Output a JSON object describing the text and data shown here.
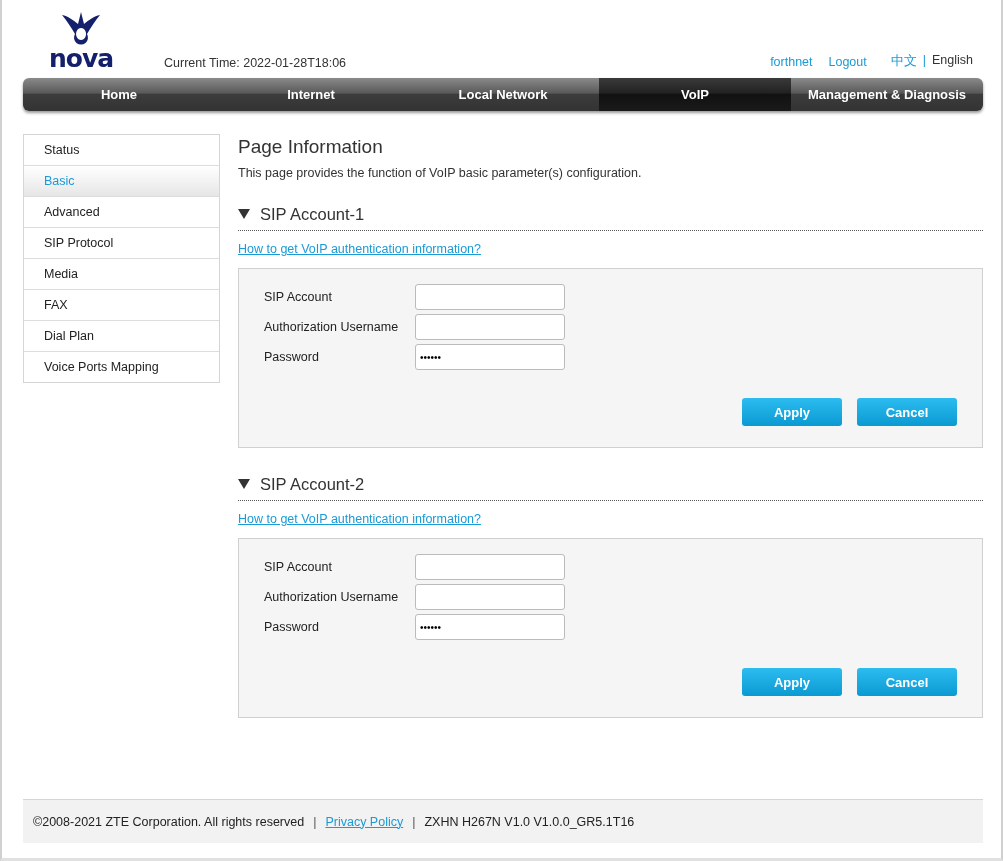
{
  "header": {
    "logo_text": "nova",
    "current_time": "Current Time: 2022-01-28T18:06",
    "user": "forthnet",
    "logout": "Logout",
    "languages": [
      {
        "label": "中文",
        "selected": false
      },
      {
        "label": "English",
        "selected": true
      }
    ],
    "language_separator": "|"
  },
  "tabs": [
    {
      "label": "Home",
      "selected": false
    },
    {
      "label": "Internet",
      "selected": false
    },
    {
      "label": "Local Network",
      "selected": false
    },
    {
      "label": "VoIP",
      "selected": true
    },
    {
      "label": "Management & Diagnosis",
      "selected": false
    }
  ],
  "sidebar": {
    "items": [
      {
        "label": "Status",
        "selected": false
      },
      {
        "label": "Basic",
        "selected": true
      },
      {
        "label": "Advanced",
        "selected": false
      },
      {
        "label": "SIP Protocol",
        "selected": false
      },
      {
        "label": "Media",
        "selected": false
      },
      {
        "label": "FAX",
        "selected": false
      },
      {
        "label": "Dial Plan",
        "selected": false
      },
      {
        "label": "Voice Ports Mapping",
        "selected": false
      }
    ]
  },
  "content": {
    "title": "Page Information",
    "description": "This page provides the function of VoIP basic parameter(s) configuration.",
    "sections": [
      {
        "title": "SIP Account-1",
        "expanded": true,
        "help_link": "How to get VoIP authentication information?",
        "fields": [
          {
            "label": "SIP Account"
          },
          {
            "label": "Authorization Username"
          },
          {
            "label": "Password",
            "value": "••••••"
          }
        ],
        "buttons": [
          "Apply",
          "Cancel"
        ]
      },
      {
        "title": "SIP Account-2",
        "expanded": true,
        "help_link": "How to get VoIP authentication information?",
        "fields": [
          {
            "label": "SIP Account"
          },
          {
            "label": "Authorization Username"
          },
          {
            "label": "Password",
            "value": "••••••"
          }
        ],
        "buttons": [
          "Apply",
          "Cancel"
        ]
      }
    ]
  },
  "footer": {
    "copyright": "©2008-2021 ZTE Corporation. All rights reserved",
    "separator_1": "|",
    "privacy_link": "Privacy Policy",
    "separator_2": "|",
    "version": "ZXHN H267N V1.0 V1.0.0_GR5.1T16"
  }
}
